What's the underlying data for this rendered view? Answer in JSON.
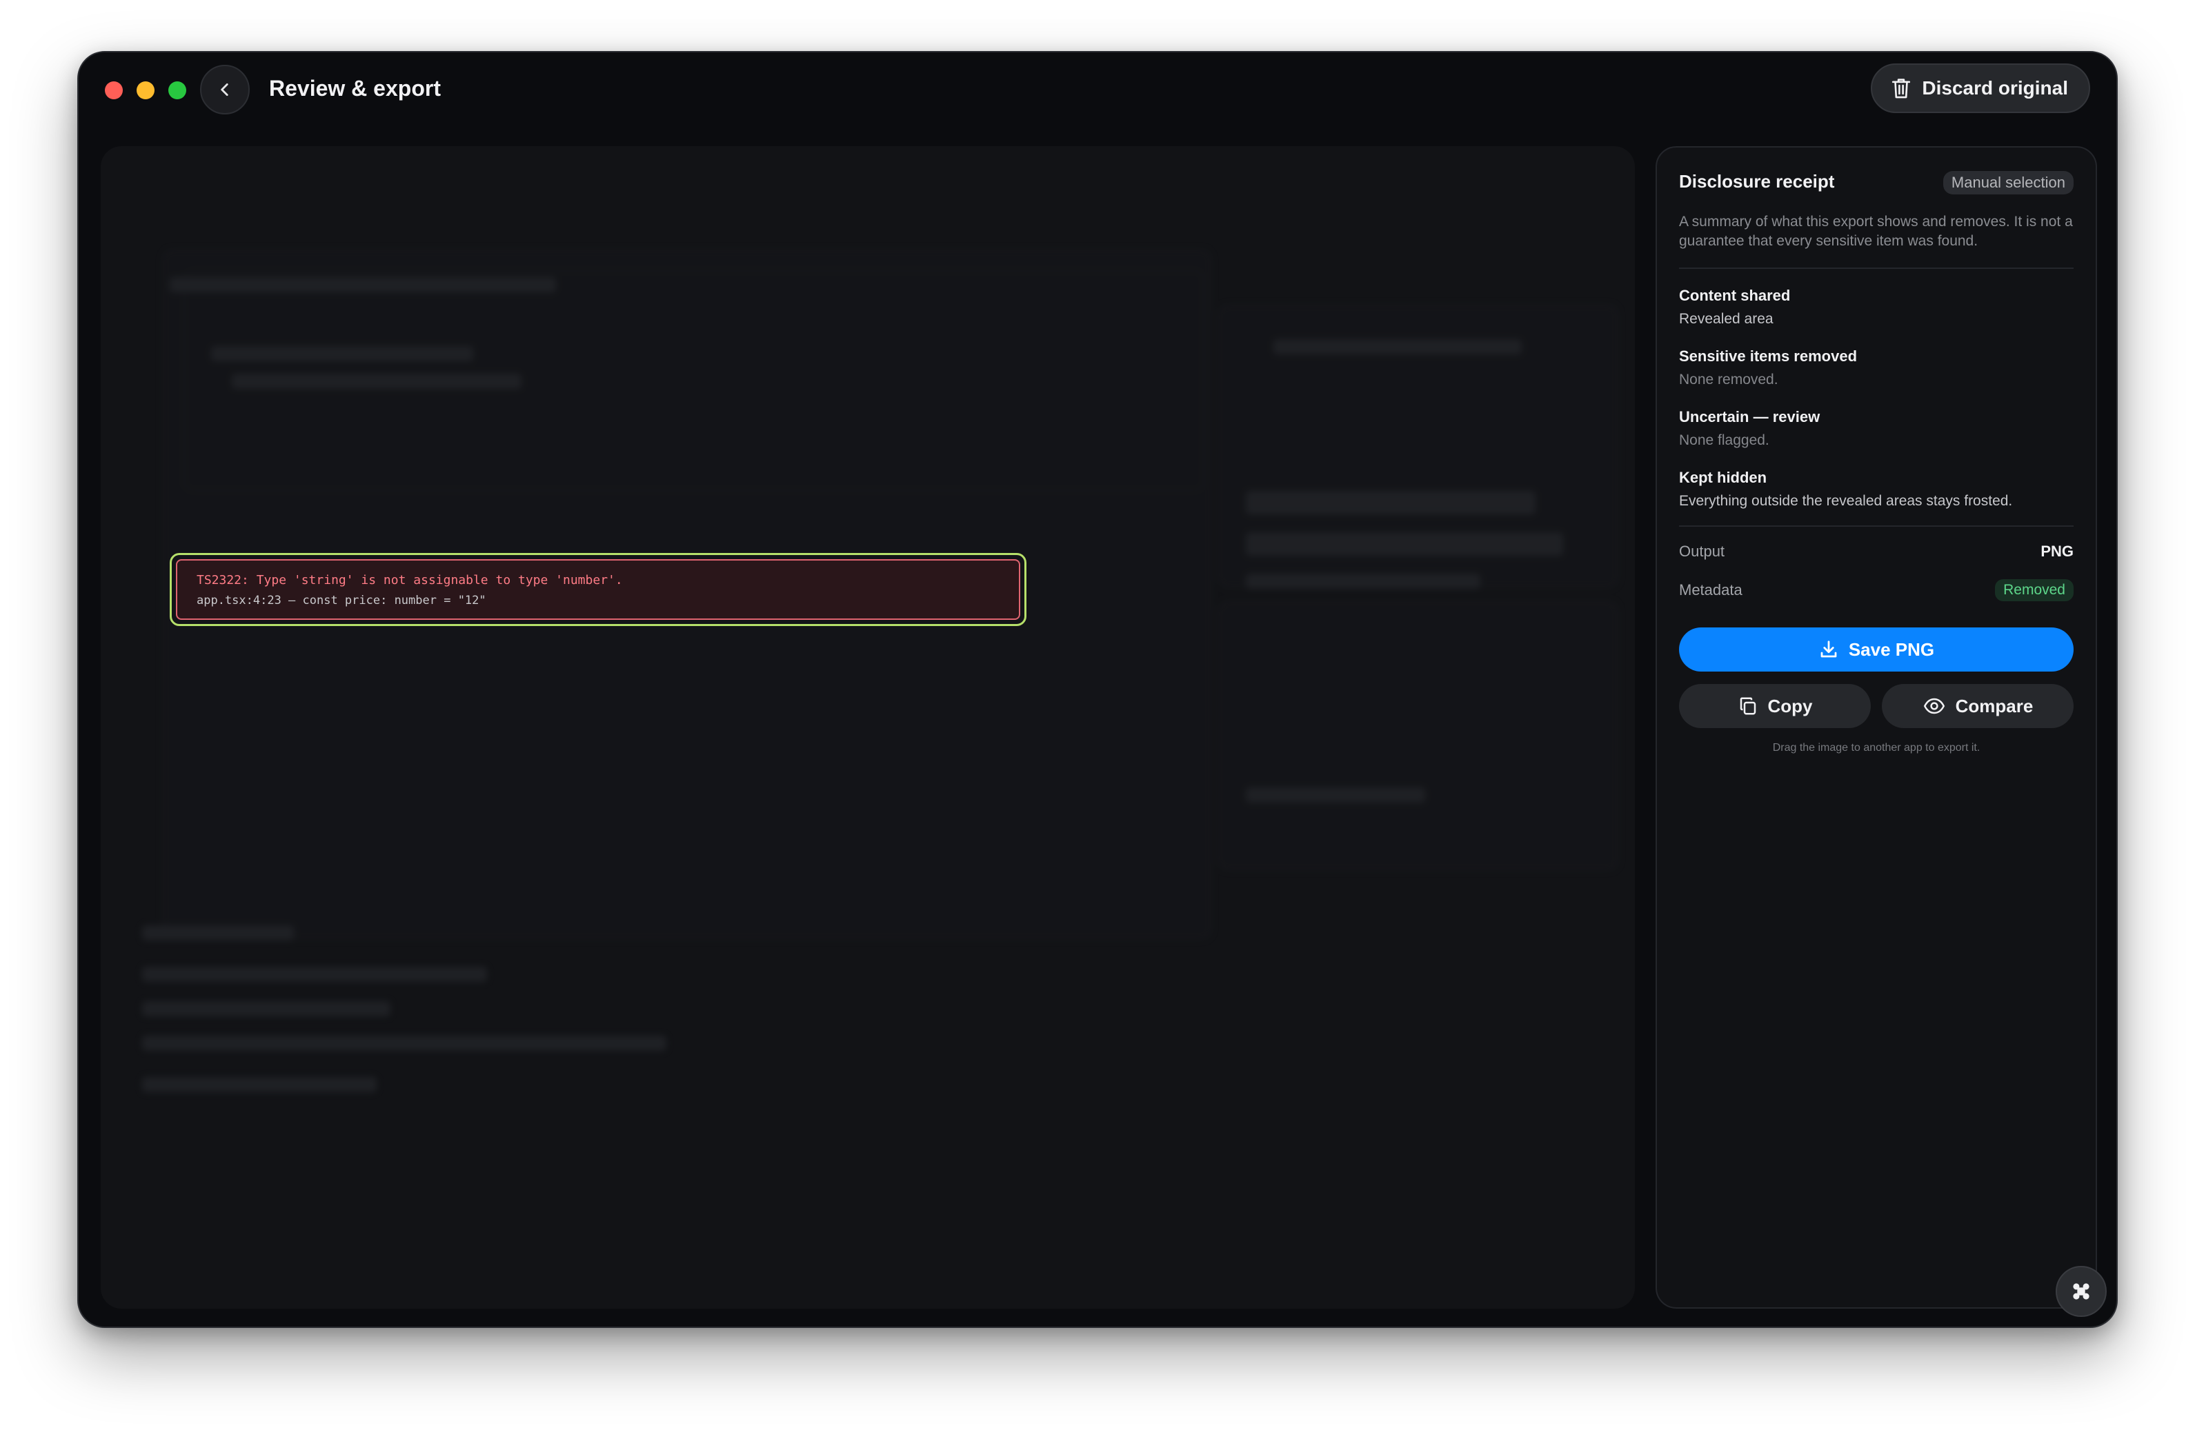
{
  "window": {
    "title": "Review & export",
    "discard_label": "Discard original"
  },
  "preview": {
    "error_message": "TS2322: Type 'string' is not assignable to type 'number'.",
    "error_location": "app.tsx:4:23 — const price: number = \"12\""
  },
  "receipt": {
    "title": "Disclosure receipt",
    "mode_badge": "Manual selection",
    "description": "A summary of what this export shows and removes. It is not a guarantee that every sensitive item was found.",
    "sections": [
      {
        "title": "Content shared",
        "value": "Revealed area"
      },
      {
        "title": "Sensitive items removed",
        "value": "None removed."
      },
      {
        "title": "Uncertain — review",
        "value": "None flagged."
      },
      {
        "title": "Kept hidden",
        "value": "Everything outside the revealed areas stays frosted."
      }
    ],
    "output_label": "Output",
    "output_value": "PNG",
    "metadata_label": "Metadata",
    "metadata_value": "Removed",
    "save_label": "Save PNG",
    "copy_label": "Copy",
    "compare_label": "Compare",
    "hint": "Drag the image to another app to export it."
  },
  "colors": {
    "accent": "#0a84ff",
    "reveal_border": "#b6e06a",
    "error_text": "#ff7c86",
    "success": "#5dd68a"
  },
  "icons": [
    "back-chevron-icon",
    "trash-icon",
    "download-icon",
    "copy-icon",
    "eye-icon",
    "command-icon"
  ]
}
